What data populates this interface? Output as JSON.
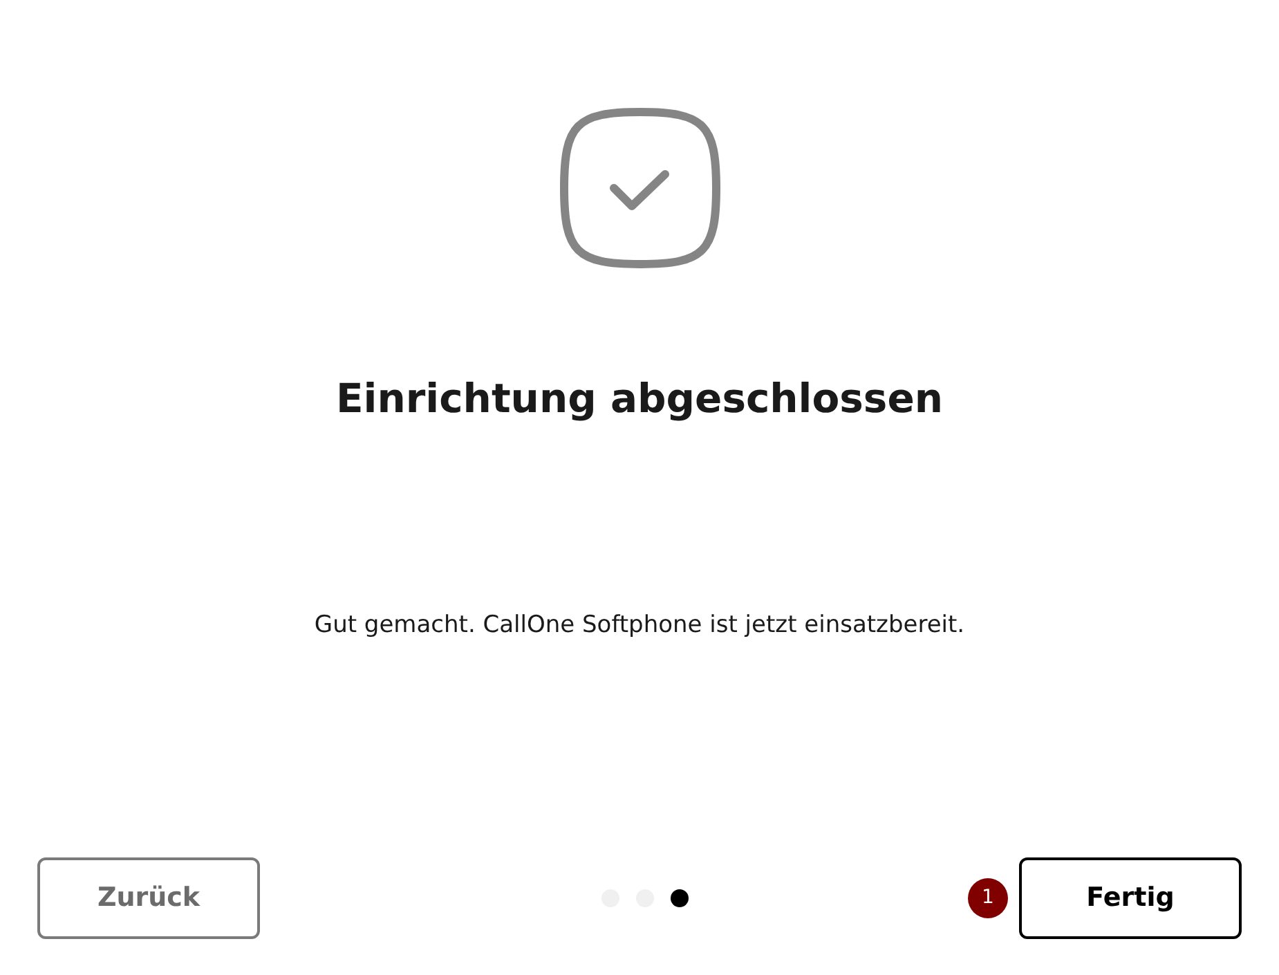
{
  "title": "Einrichtung abgeschlossen",
  "message": "Gut gemacht. CallOne Softphone ist jetzt einsatzbereit.",
  "back_button": {
    "label": "Zurück"
  },
  "steps": [
    {
      "selected": false
    },
    {
      "selected": false
    },
    {
      "selected": true
    }
  ],
  "badge": "1",
  "finish_button": {
    "label": "Fertig"
  }
}
